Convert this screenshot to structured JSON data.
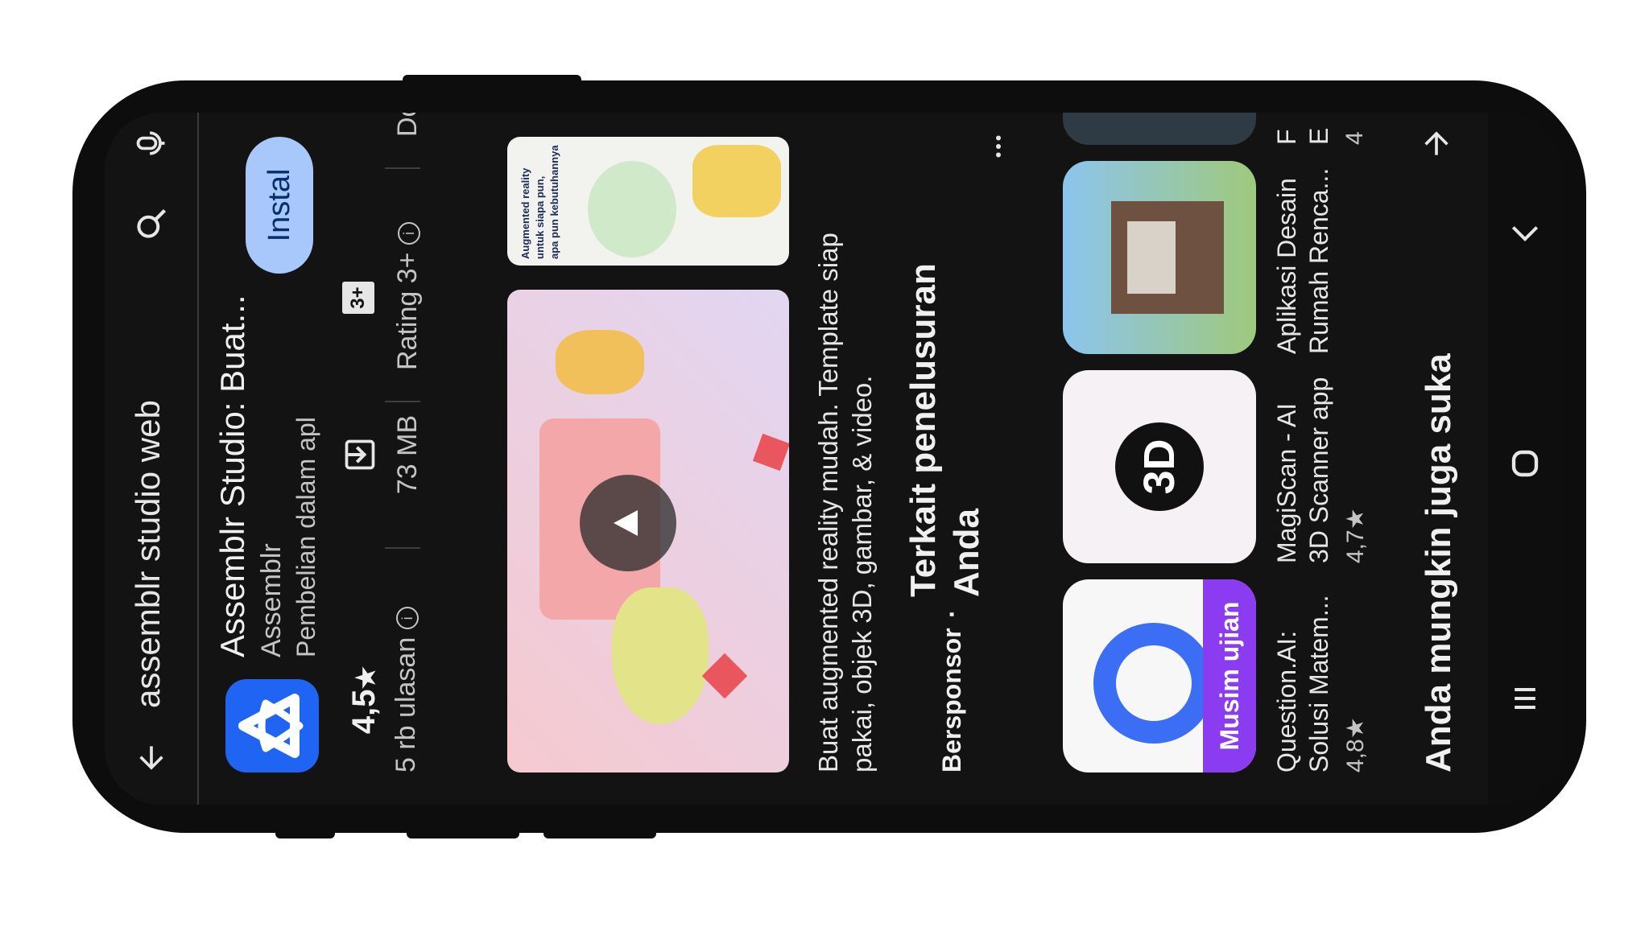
{
  "search": {
    "query": "assemblr studio web"
  },
  "app": {
    "name": "Assemblr Studio: Buat...",
    "developer": "Assemblr",
    "iap": "Pembelian dalam apl",
    "install_label": "Instal"
  },
  "stats": {
    "rating": "4,5",
    "star": "★",
    "reviews": "5 rb ulasan",
    "size": "73 MB",
    "age_badge": "3+",
    "age": "Rating 3+",
    "next": "Do"
  },
  "promo": {
    "card_line1": "Augmented reality",
    "card_line2": "untuk siapa pun,",
    "card_line3": "apa pun kebutuhannya"
  },
  "description": {
    "line1": "Buat augmented reality mudah. Template siap",
    "line2": "pakai, objek 3D, gambar, & video."
  },
  "related": {
    "sponsored": "Bersponsor",
    "dot": "·",
    "title_line1": "Terkait penelusuran",
    "title_line2": "Anda",
    "apps": [
      {
        "name1": "Question.AI:",
        "name2": "Solusi Matem...",
        "rating": "4,8★",
        "banner": "Musim ujian"
      },
      {
        "name1": "MagiScan - AI",
        "name2": "3D Scanner app",
        "rating": "4,7★",
        "badge": "3D"
      },
      {
        "name1": "Aplikasi Desain",
        "name2": "Rumah Renca...",
        "rating": ""
      },
      {
        "name1": "F",
        "name2": "E",
        "rating": "4"
      }
    ]
  },
  "more": {
    "title": "Anda mungkin juga suka"
  },
  "nav": {},
  "colors": {
    "install_bg": "#a8c7fa",
    "app_blue": "#1f64f2",
    "background": "#131313"
  }
}
